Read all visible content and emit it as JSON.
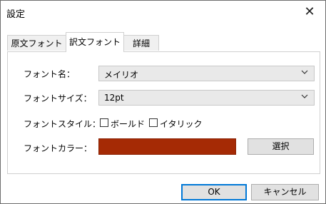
{
  "window": {
    "title": "設定",
    "close_glyph": "✕"
  },
  "tabs": [
    {
      "label": "原文フォント",
      "active": false
    },
    {
      "label": "訳文フォント",
      "active": true
    },
    {
      "label": "詳細",
      "active": false
    }
  ],
  "form": {
    "font_name_label": "フォント名：",
    "font_name_value": "メイリオ",
    "font_size_label": "フォントサイズ：",
    "font_size_value": "12pt",
    "font_style_label": "フォントスタイル：",
    "bold_label": "ボールド",
    "bold_checked": false,
    "italic_label": "イタリック",
    "italic_checked": false,
    "font_color_label": "フォントカラー：",
    "font_color": "#a52a05",
    "select_button": "選択"
  },
  "footer": {
    "ok": "OK",
    "cancel": "キャンセル"
  },
  "icons": {
    "dropdown": "chevron-down-icon",
    "close": "close-icon"
  }
}
